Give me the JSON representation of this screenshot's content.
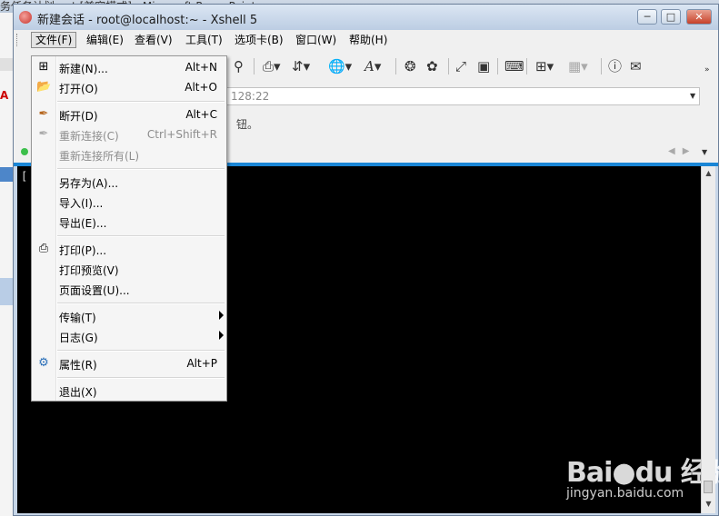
{
  "background": {
    "title_fragment": "务任务计划.ppt [兼容模式] - Microsoft PowerPoint"
  },
  "window": {
    "title": "新建会话 - root@localhost:~ - Xshell 5"
  },
  "menubar": {
    "items": [
      "文件(F)",
      "编辑(E)",
      "查看(V)",
      "工具(T)",
      "选项卡(B)",
      "窗口(W)",
      "帮助(H)"
    ]
  },
  "address": {
    "value_fragment": "128:22"
  },
  "tipbar": {
    "text_fragment": "钮。"
  },
  "terminal": {
    "visible_text": "["
  },
  "file_menu": {
    "items": [
      {
        "label": "新建(N)...",
        "shortcut": "Alt+N",
        "icon": "new-session-icon"
      },
      {
        "label": "打开(O)",
        "shortcut": "Alt+O",
        "icon": "open-folder-icon"
      },
      {
        "label": "断开(D)",
        "shortcut": "Alt+C",
        "icon": "disconnect-icon"
      },
      {
        "label": "重新连接(C)",
        "shortcut": "Ctrl+Shift+R",
        "icon": "reconnect-icon",
        "disabled": true
      },
      {
        "label": "重新连接所有(L)",
        "shortcut": "",
        "disabled": true
      },
      {
        "label": "另存为(A)...",
        "shortcut": ""
      },
      {
        "label": "导入(I)...",
        "shortcut": ""
      },
      {
        "label": "导出(E)...",
        "shortcut": ""
      },
      {
        "label": "打印(P)...",
        "shortcut": "",
        "icon": "printer-icon"
      },
      {
        "label": "打印预览(V)",
        "shortcut": ""
      },
      {
        "label": "页面设置(U)...",
        "shortcut": ""
      },
      {
        "label": "传输(T)",
        "shortcut": "",
        "submenu": true
      },
      {
        "label": "日志(G)",
        "shortcut": "",
        "submenu": true
      },
      {
        "label": "属性(R)",
        "shortcut": "Alt+P",
        "icon": "properties-icon"
      },
      {
        "label": "退出(X)",
        "shortcut": ""
      }
    ]
  },
  "watermark": {
    "brand": "Bai●du 经验",
    "url": "jingyan.baidu.com"
  },
  "colors": {
    "accent_blue": "#1a86d6",
    "terminal_bg": "#000000",
    "menu_bg": "#f5f5f5"
  }
}
